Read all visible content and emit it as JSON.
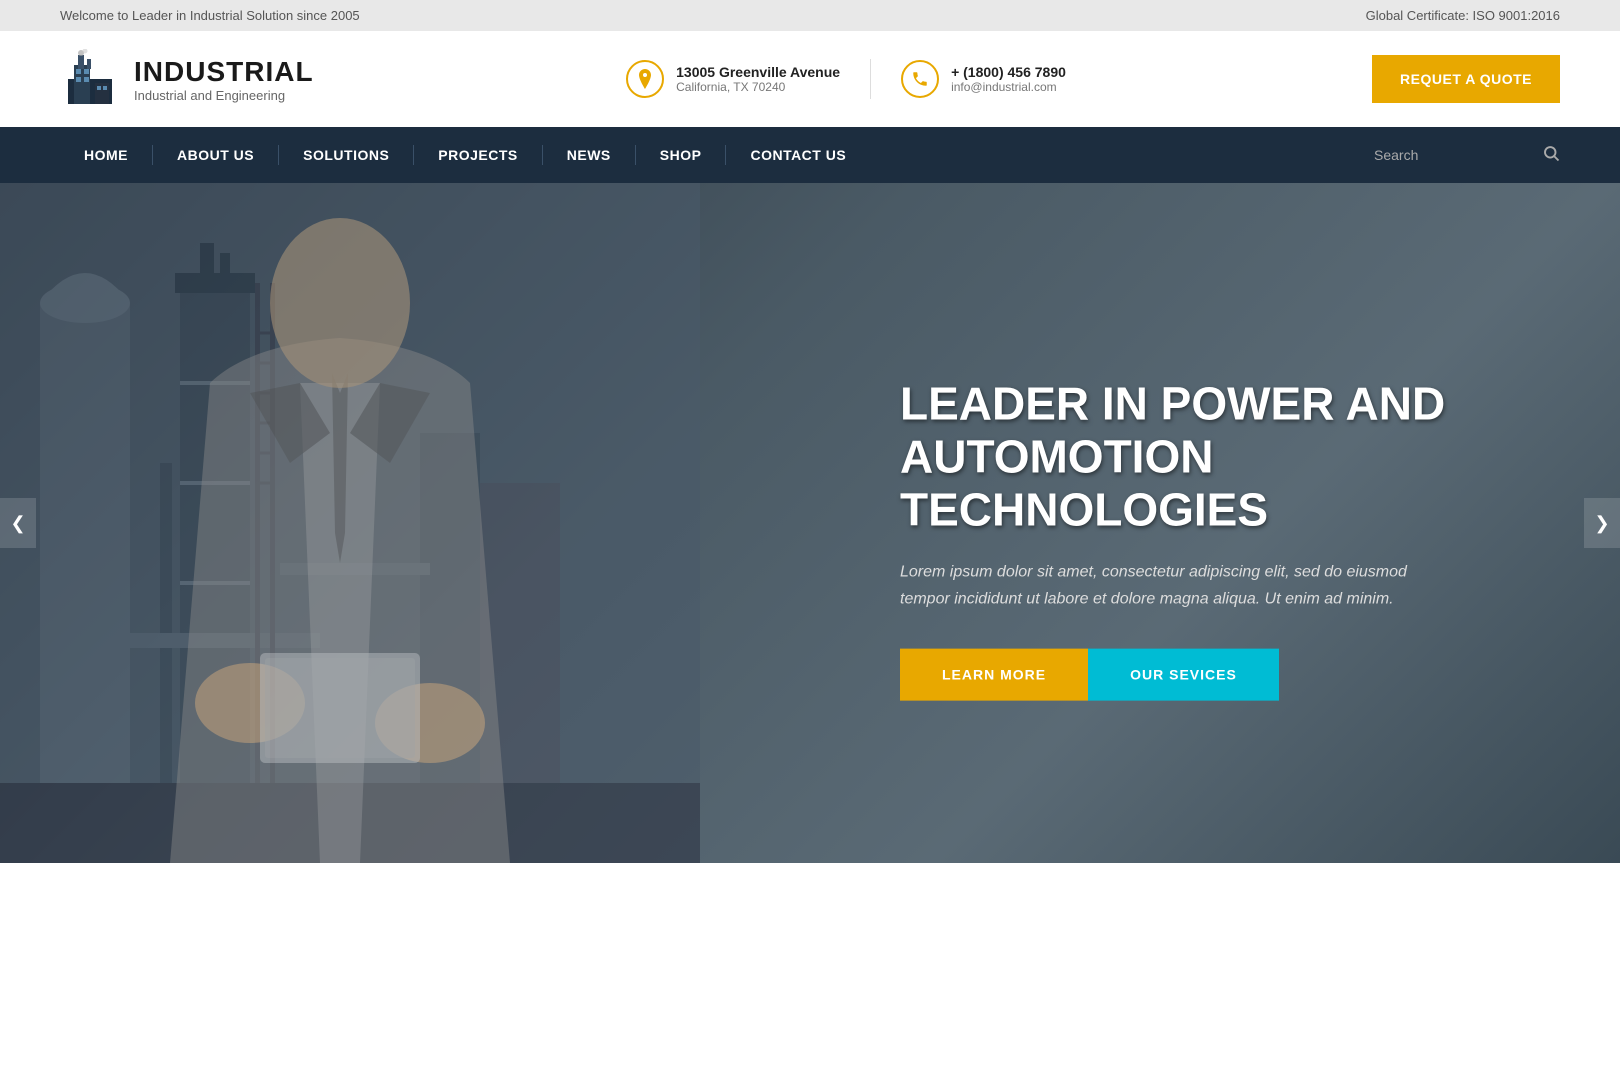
{
  "topbar": {
    "welcome_text": "Welcome to Leader in Industrial Solution since 2005",
    "certificate_text": "Global Certificate: ISO 9001:2016"
  },
  "header": {
    "logo": {
      "title": "INDUSTRIAL",
      "subtitle": "Industrial and Engineering"
    },
    "address": {
      "line1": "13005 Greenville Avenue",
      "line2": "California, TX 70240"
    },
    "phone": {
      "line1": "+ (1800) 456 7890",
      "line2": "info@industrial.com"
    },
    "quote_button": "REQUET A QUOTE"
  },
  "nav": {
    "items": [
      {
        "label": "HOME",
        "active": true
      },
      {
        "label": "ABOUT US",
        "active": false
      },
      {
        "label": "SOLUTIONS",
        "active": false
      },
      {
        "label": "PROJECTS",
        "active": false
      },
      {
        "label": "NEWS",
        "active": false
      },
      {
        "label": "SHOP",
        "active": false
      },
      {
        "label": "CONTACT US",
        "active": false
      }
    ],
    "search_placeholder": "Search"
  },
  "hero": {
    "title": "LEADER IN POWER AND AUTOMOTION TECHNOLOGIES",
    "description": "Lorem ipsum dolor sit amet, consectetur adipiscing elit, sed do eiusmod tempor incididunt ut labore et dolore magna aliqua. Ut enim ad minim.",
    "btn_learn": "LEARN MORE",
    "btn_services": "OUR SEVICES",
    "arrow_left": "❮",
    "arrow_right": "❯"
  }
}
